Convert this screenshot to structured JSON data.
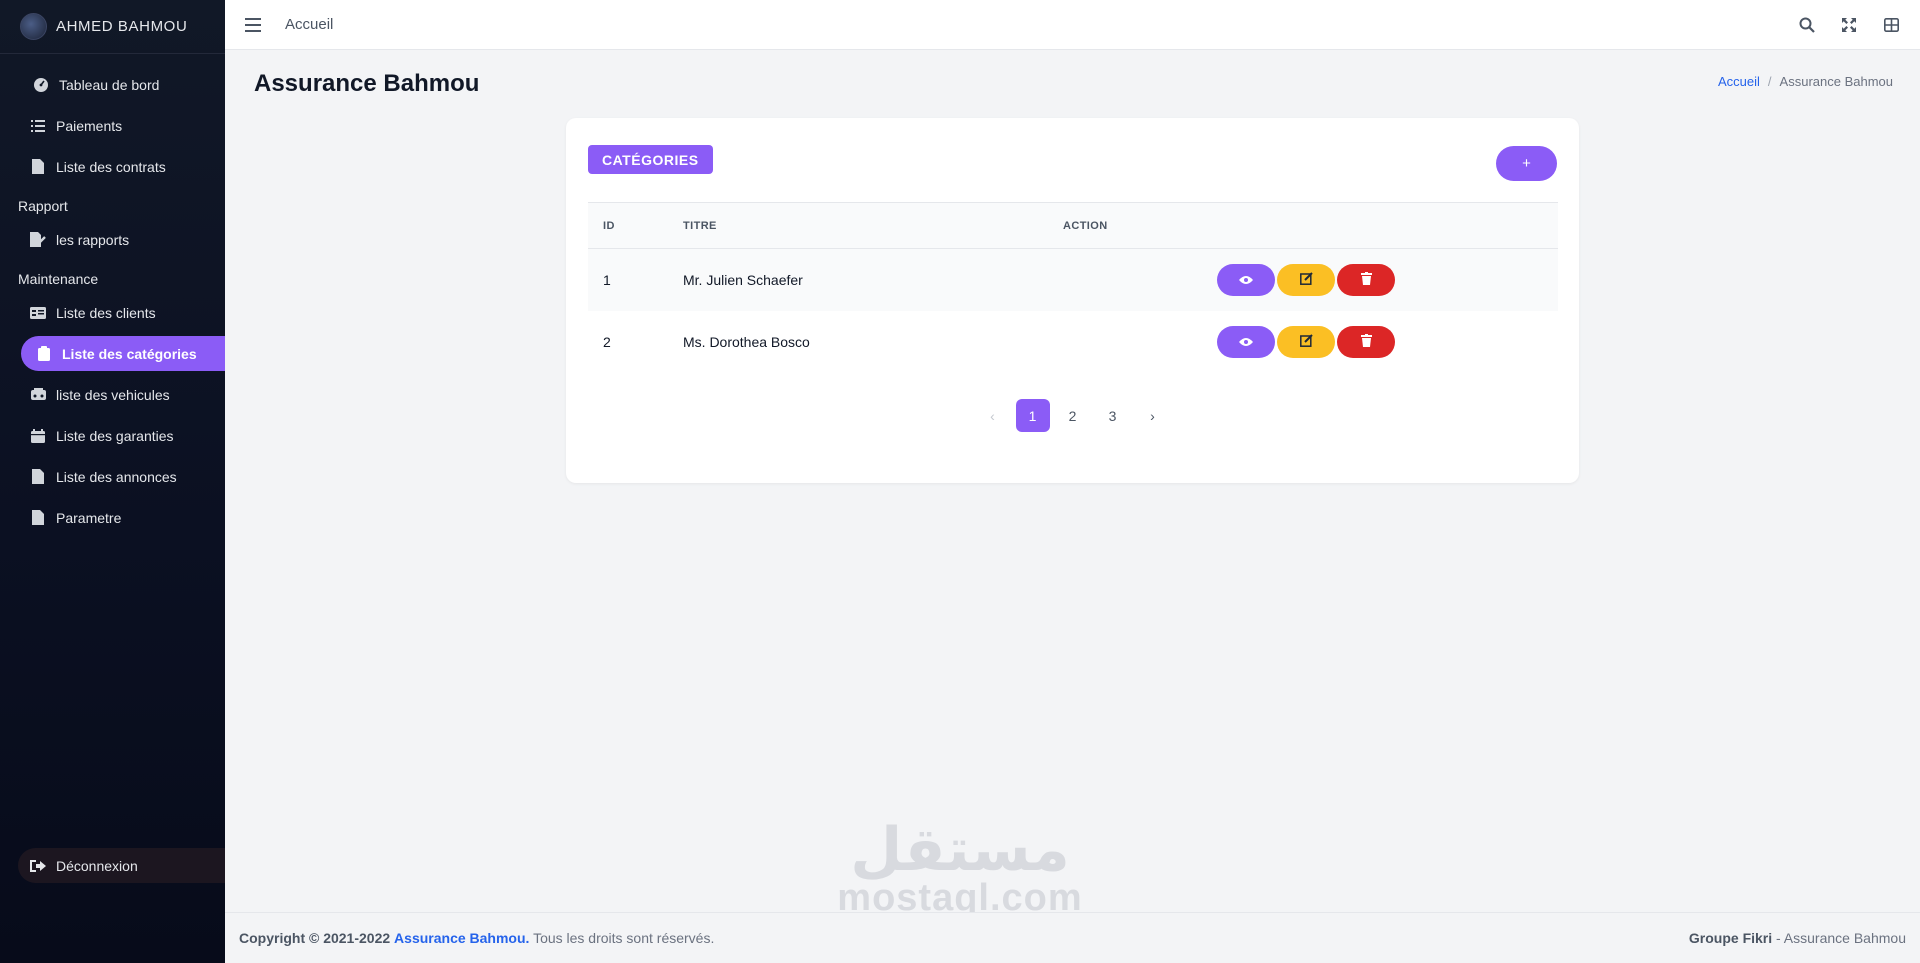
{
  "brand": {
    "name": "AHMED BAHMOU"
  },
  "sidebar": {
    "items": [
      {
        "label": "Tableau de bord",
        "icon": "dashboard-icon"
      },
      {
        "label": "Paiements",
        "icon": "list-icon"
      },
      {
        "label": "Liste des contrats",
        "icon": "file-icon"
      }
    ],
    "section_rapport": "Rapport",
    "rapport_items": [
      {
        "label": "les rapports",
        "icon": "file-signature-icon"
      }
    ],
    "section_maintenance": "Maintenance",
    "maintenance_items": [
      {
        "label": "Liste des clients",
        "icon": "id-card-icon"
      },
      {
        "label": "Liste des catégories",
        "icon": "clipboard-icon",
        "active": true
      },
      {
        "label": "liste des vehicules",
        "icon": "car-icon"
      },
      {
        "label": "Liste des garanties",
        "icon": "calendar-icon"
      },
      {
        "label": "Liste des annonces",
        "icon": "file-icon"
      },
      {
        "label": "Parametre",
        "icon": "file-icon"
      }
    ],
    "logout": "Déconnexion"
  },
  "topbar": {
    "home": "Accueil"
  },
  "page": {
    "title": "Assurance Bahmou"
  },
  "breadcrumb": {
    "home": "Accueil",
    "separator": "/",
    "current": "Assurance Bahmou"
  },
  "card": {
    "badge": "CATÉGORIES",
    "add_label": "+",
    "columns": {
      "id": "ID",
      "title": "TITRE",
      "action": "ACTION"
    },
    "rows": [
      {
        "id": "1",
        "title": "Mr. Julien Schaefer"
      },
      {
        "id": "2",
        "title": "Ms. Dorothea Bosco"
      }
    ],
    "pagination": {
      "prev": "‹",
      "pages": [
        "1",
        "2",
        "3"
      ],
      "next": "›",
      "current": "1"
    }
  },
  "watermark": {
    "arabic": "مستقل",
    "latin": "mostaql.com"
  },
  "footer": {
    "copyright": "Copyright © 2021-2022",
    "brand": "Assurance Bahmou.",
    "rights": "Tous les droits sont réservés.",
    "right_bold": "Groupe Fikri",
    "right_rest": "- Assurance Bahmou"
  },
  "colors": {
    "accent": "#8b5cf6",
    "warning": "#fbbf24",
    "danger": "#dc2626",
    "link": "#2563eb"
  }
}
